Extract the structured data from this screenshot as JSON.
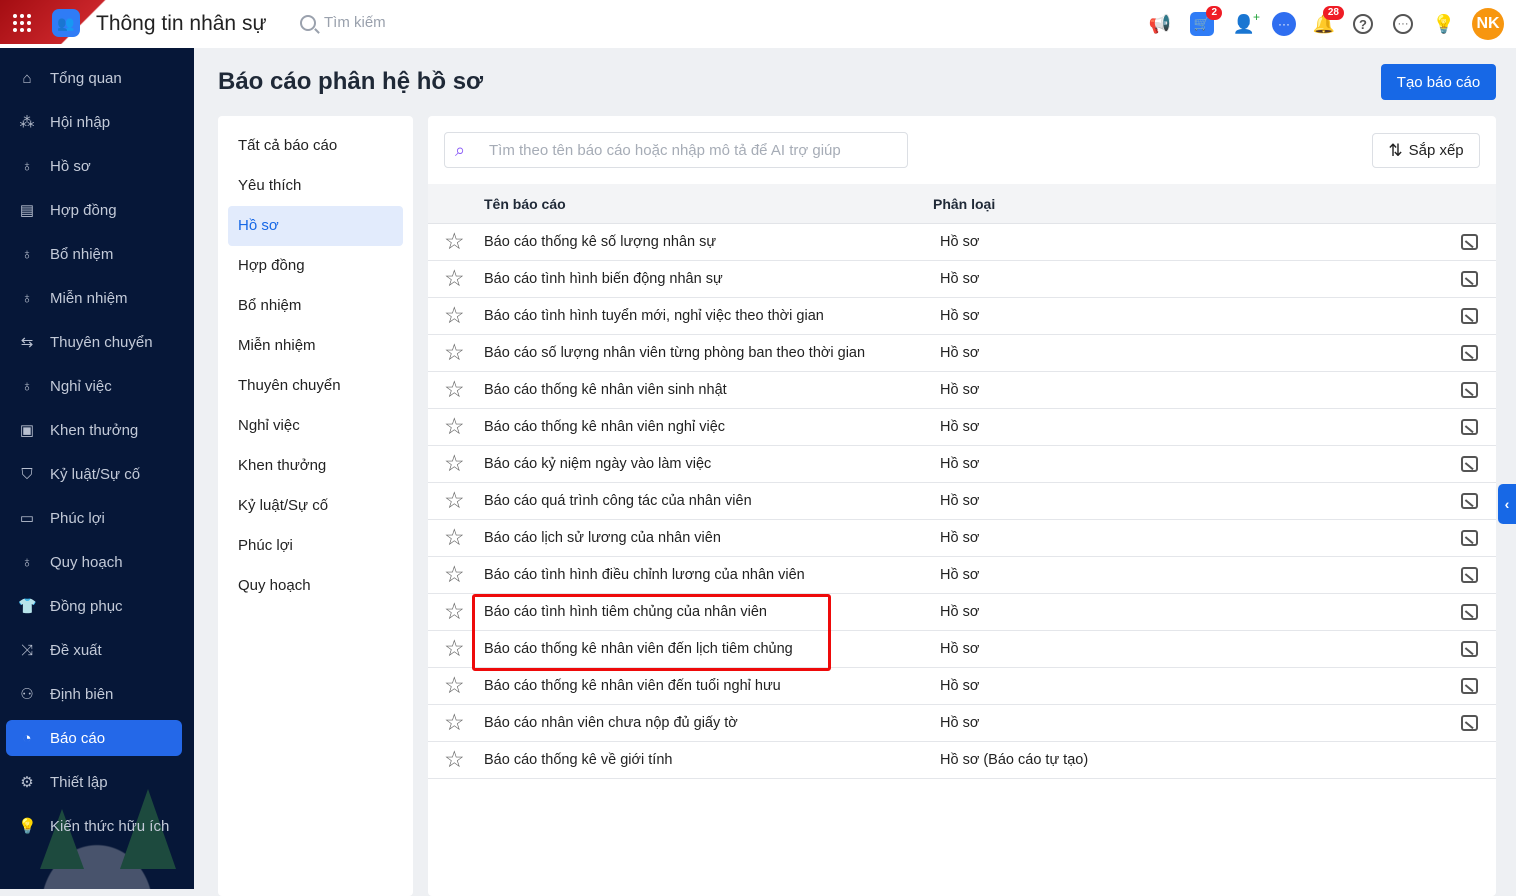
{
  "header": {
    "app_title": "Thông tin nhân sự",
    "search_placeholder": "Tìm kiếm",
    "cart_badge": "2",
    "notification_badge": "28",
    "avatar_initials": "NK"
  },
  "sidebar": {
    "items": [
      {
        "label": "Tổng quan",
        "icon": "home-icon"
      },
      {
        "label": "Hội nhập",
        "icon": "group-icon"
      },
      {
        "label": "Hồ sơ",
        "icon": "user-icon"
      },
      {
        "label": "Hợp đồng",
        "icon": "document-icon"
      },
      {
        "label": "Bổ nhiệm",
        "icon": "user-plus-icon"
      },
      {
        "label": "Miễn nhiệm",
        "icon": "user-minus-icon"
      },
      {
        "label": "Thuyên chuyển",
        "icon": "transfer-icon"
      },
      {
        "label": "Nghỉ việc",
        "icon": "user-x-icon"
      },
      {
        "label": "Khen thưởng",
        "icon": "reward-icon"
      },
      {
        "label": "Kỷ luật/Sự cố",
        "icon": "shield-icon"
      },
      {
        "label": "Phúc lợi",
        "icon": "benefit-icon"
      },
      {
        "label": "Quy hoạch",
        "icon": "users-icon"
      },
      {
        "label": "Đồng phục",
        "icon": "shirt-icon"
      },
      {
        "label": "Đề xuất",
        "icon": "proposal-icon"
      },
      {
        "label": "Định biên",
        "icon": "headcount-icon"
      },
      {
        "label": "Báo cáo",
        "icon": "pie-chart-icon",
        "active": true
      },
      {
        "label": "Thiết lập",
        "icon": "gear-icon"
      },
      {
        "label": "Kiến thức hữu ích",
        "icon": "knowledge-icon"
      }
    ]
  },
  "page": {
    "title": "Báo cáo phân hệ hồ sơ",
    "create_button": "Tạo báo cáo"
  },
  "categories": [
    "Tất cả báo cáo",
    "Yêu thích",
    "Hồ sơ",
    "Hợp đồng",
    "Bổ nhiệm",
    "Miễn nhiệm",
    "Thuyên chuyển",
    "Nghỉ việc",
    "Khen thưởng",
    "Kỷ luật/Sự cố",
    "Phúc lợi",
    "Quy hoạch"
  ],
  "active_category": "Hồ sơ",
  "search": {
    "placeholder": "Tìm theo tên báo cáo hoặc nhập mô tả để AI trợ giúp"
  },
  "sort_button": "Sắp xếp",
  "table": {
    "headers": {
      "name": "Tên báo cáo",
      "type": "Phân loại"
    },
    "rows": [
      {
        "name": "Báo cáo thống kê số lượng nhân sự",
        "type": "Hồ sơ",
        "preview": true
      },
      {
        "name": "Báo cáo tình hình biến động nhân sự",
        "type": "Hồ sơ",
        "preview": true
      },
      {
        "name": "Báo cáo tình hình tuyển mới, nghỉ việc theo thời gian",
        "type": "Hồ sơ",
        "preview": true
      },
      {
        "name": "Báo cáo số lượng nhân viên từng phòng ban theo thời gian",
        "type": "Hồ sơ",
        "preview": true
      },
      {
        "name": "Báo cáo thống kê nhân viên sinh nhật",
        "type": "Hồ sơ",
        "preview": true
      },
      {
        "name": "Báo cáo thống kê nhân viên nghỉ việc",
        "type": "Hồ sơ",
        "preview": true
      },
      {
        "name": "Báo cáo kỷ niệm ngày vào làm việc",
        "type": "Hồ sơ",
        "preview": true
      },
      {
        "name": "Báo cáo quá trình công tác của nhân viên",
        "type": "Hồ sơ",
        "preview": true
      },
      {
        "name": "Báo cáo lịch sử lương của nhân viên",
        "type": "Hồ sơ",
        "preview": true
      },
      {
        "name": "Báo cáo tình hình điều chỉnh lương của nhân viên",
        "type": "Hồ sơ",
        "preview": true
      },
      {
        "name": "Báo cáo tình hình tiêm chủng của nhân viên",
        "type": "Hồ sơ",
        "preview": true
      },
      {
        "name": "Báo cáo thống kê nhân viên đến lịch tiêm chủng",
        "type": "Hồ sơ",
        "preview": true
      },
      {
        "name": "Báo cáo thống kê nhân viên đến tuổi nghỉ hưu",
        "type": "Hồ sơ",
        "preview": true
      },
      {
        "name": "Báo cáo nhân viên chưa nộp đủ giấy tờ",
        "type": "Hồ sơ",
        "preview": true
      },
      {
        "name": "Báo cáo thống kê về giới tính",
        "type": "Hồ sơ (Báo cáo tự tạo)",
        "preview": false
      }
    ]
  },
  "colors": {
    "primary": "#1768e6",
    "sidebar_bg": "#061738",
    "highlight": "#ee0a0a"
  }
}
